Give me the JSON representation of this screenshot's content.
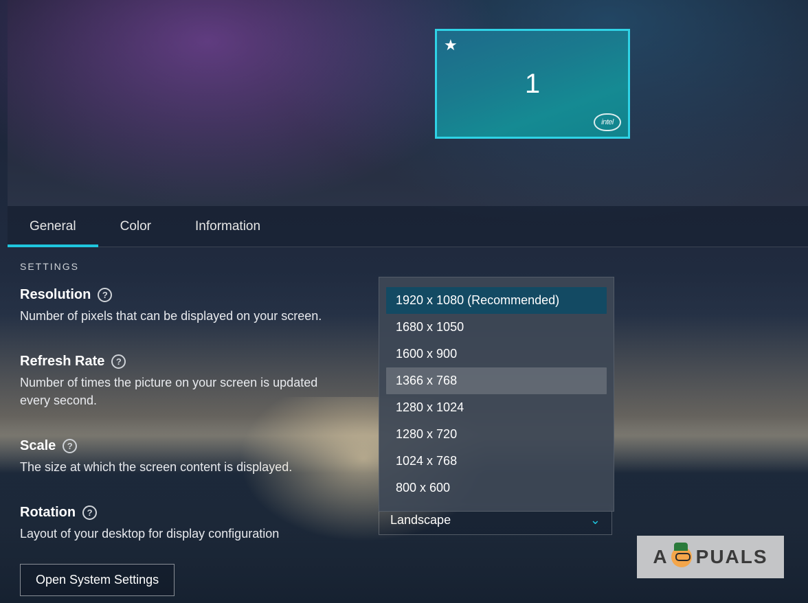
{
  "display": {
    "monitor_number": "1",
    "logo_text": "intel"
  },
  "tabs": {
    "general": "General",
    "color": "Color",
    "information": "Information"
  },
  "section_header": "SETTINGS",
  "settings": {
    "resolution": {
      "label": "Resolution",
      "desc": "Number of pixels that can be displayed on your screen."
    },
    "refresh": {
      "label": "Refresh Rate",
      "desc": "Number of times the picture on your screen is updated every second."
    },
    "scale": {
      "label": "Scale",
      "desc": "The size at which the screen content is displayed."
    },
    "rotation": {
      "label": "Rotation",
      "desc": "Layout of your desktop for display configuration",
      "value": "Landscape"
    }
  },
  "resolution_options": [
    "1920 x 1080 (Recommended)",
    "1680 x 1050",
    "1600 x 900",
    "1366 x 768",
    "1280 x 1024",
    "1280 x 720",
    "1024 x 768",
    "800 x 600"
  ],
  "resolution_selected_index": 0,
  "resolution_hover_index": 3,
  "open_system_settings": "Open System Settings",
  "watermark": {
    "brand_left": "A",
    "brand_right": "PUALS"
  }
}
